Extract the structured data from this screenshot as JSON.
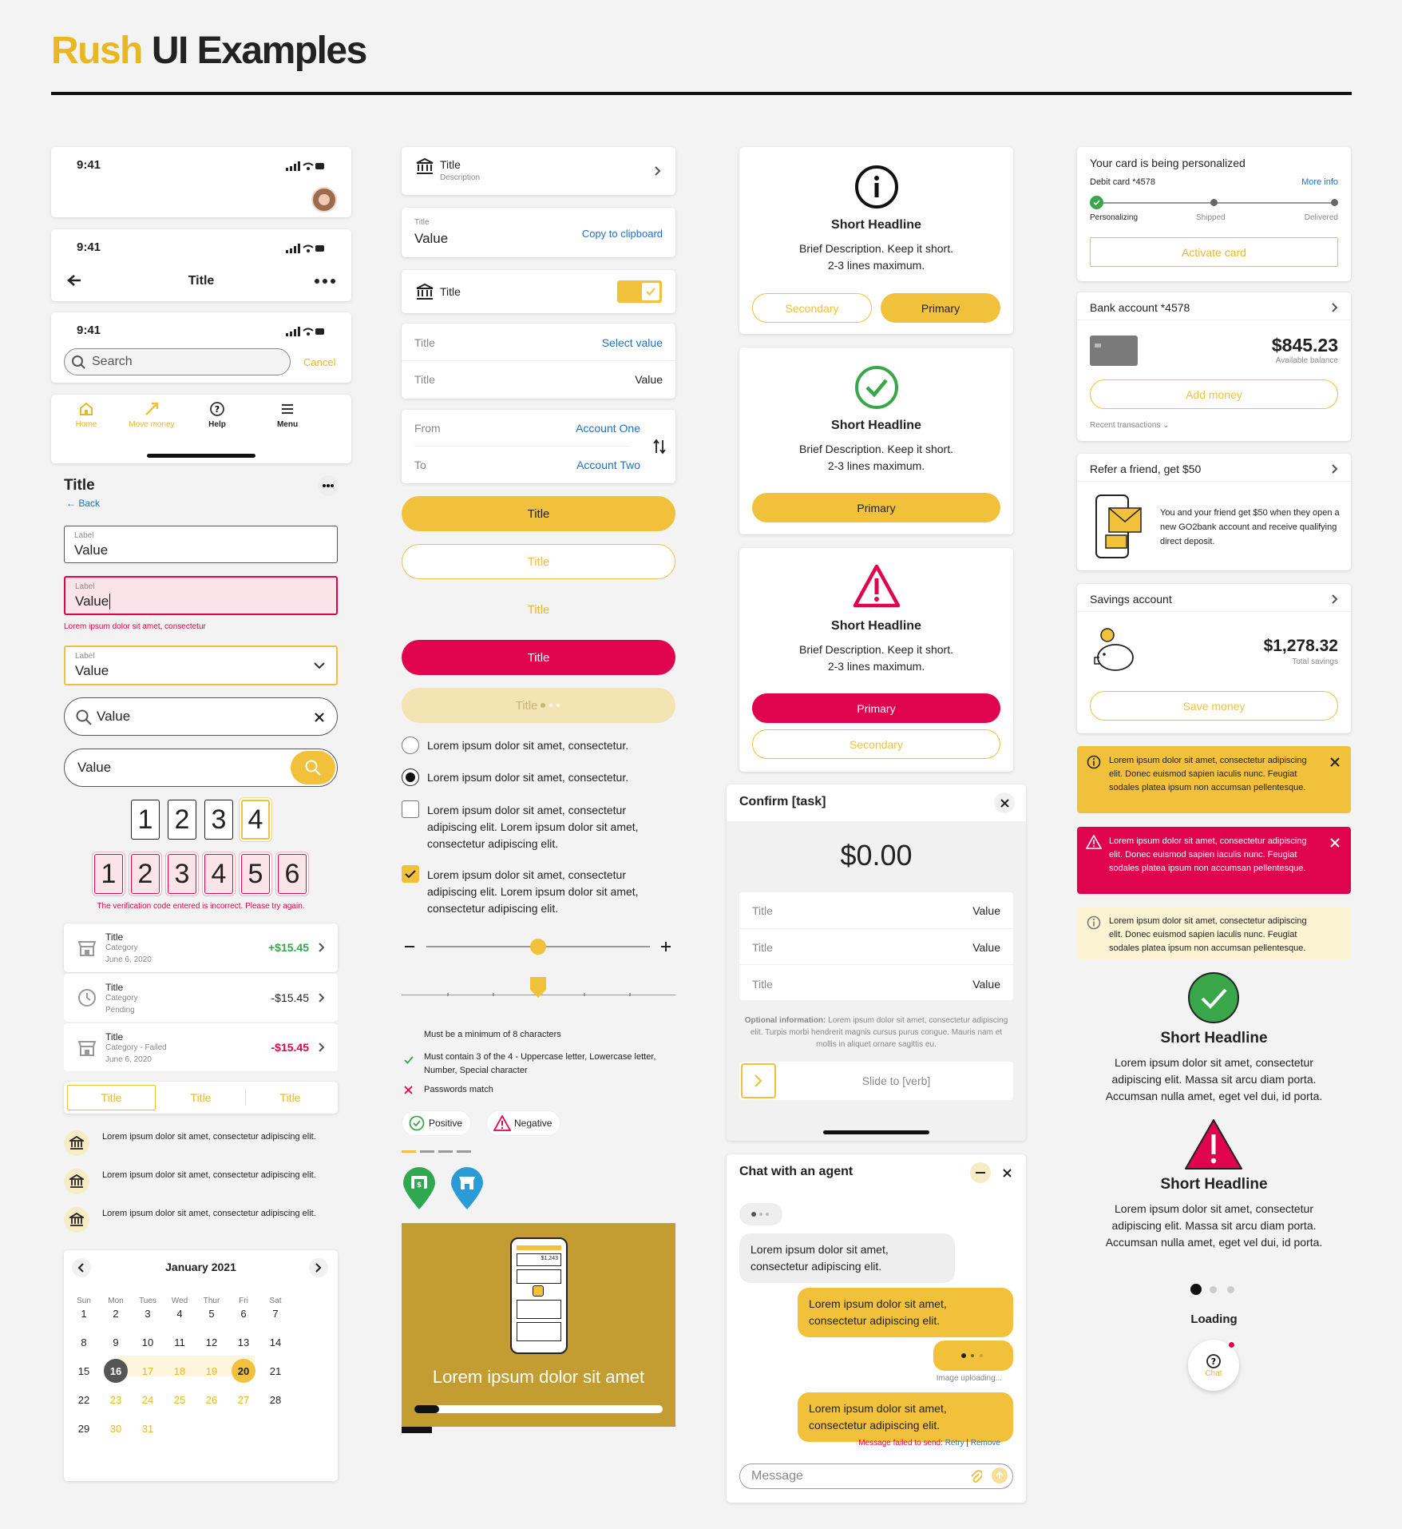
{
  "header": {
    "brand": "Rush",
    "title": " UI Examples"
  },
  "phone": {
    "time": "9:41",
    "nav_title": "Title",
    "search_placeholder": "Search",
    "cancel": "Cancel",
    "tabs": [
      {
        "label": "Home"
      },
      {
        "label": "Move money"
      },
      {
        "label": "Help"
      },
      {
        "label": "Menu"
      }
    ]
  },
  "form": {
    "page_title": "Title",
    "back": "Back",
    "label": "Label",
    "value": "Value",
    "error": "Lorem ipsum dolor sit amet, consectetur",
    "search_value": "Value",
    "search_value2": "Value",
    "code4": [
      "1",
      "2",
      "3",
      "4"
    ],
    "code6": [
      "1",
      "2",
      "3",
      "4",
      "5",
      "6"
    ],
    "code_error": "The verification code entered is incorrect. Please try again."
  },
  "transactions": [
    {
      "title": "Title",
      "category": "Category",
      "sub": "June 6, 2020",
      "amount": "+$15.45",
      "color": "#3aa64a"
    },
    {
      "title": "Title",
      "category": "Category",
      "sub": "Pending",
      "amount": "-$15.45",
      "color": "#222"
    },
    {
      "title": "Title",
      "category": "Category - Failed",
      "sub": "June 6, 2020",
      "amount": "-$15.45",
      "color": "#e0034d"
    }
  ],
  "seg": [
    "Title",
    "Title",
    "Title"
  ],
  "bank_items": [
    "Lorem ipsum dolor sit amet, consectetur adipiscing elit.",
    "Lorem ipsum dolor sit amet, consectetur adipiscing elit.",
    "Lorem ipsum dolor sit amet, consectetur adipiscing elit."
  ],
  "calendar": {
    "month": "January 2021",
    "days": [
      "Sun",
      "Mon",
      "Tues",
      "Wed",
      "Thur",
      "Fri",
      "Sat"
    ],
    "dates": [
      "1",
      "2",
      "3",
      "4",
      "5",
      "6",
      "7",
      "8",
      "9",
      "10",
      "11",
      "12",
      "13",
      "14",
      "15",
      "16",
      "17",
      "18",
      "19",
      "20",
      "21",
      "22",
      "23",
      "24",
      "25",
      "26",
      "27",
      "28",
      "29",
      "30",
      "31"
    ]
  },
  "col2": {
    "list_title": "Title",
    "list_desc": "Description",
    "copy_label": "Title",
    "copy_value": "Value",
    "copy_link": "Copy to clipboard",
    "toggle_title": "Title",
    "sel_title": "Title",
    "sel_link": "Select value",
    "val_title": "Title",
    "val_value": "Value",
    "from": "From",
    "from_val": "Account One",
    "to": "To",
    "to_val": "Account Two",
    "buttons": [
      "Title",
      "Title",
      "Title",
      "Title",
      "Title"
    ],
    "radio1": "Lorem ipsum dolor sit amet, consectetur.",
    "radio2": "Lorem ipsum dolor sit amet, consectetur.",
    "check1": "Lorem ipsum dolor sit amet, consectetur adipiscing elit. Lorem ipsum dolor sit amet, consectetur adipiscing elit.",
    "check2": "Lorem ipsum dolor sit amet, consectetur adipiscing elit. Lorem ipsum dolor sit amet, consectetur adipiscing elit.",
    "slider_value": 0.5,
    "pw1": "Must be a minimum of 8 characters",
    "pw2": "Must contain 3 of the 4 - Uppercase letter, Lowercase letter, Number, Special character",
    "pw3": "Passwords match",
    "positive": "Positive",
    "negative": "Negative",
    "promo": "Lorem ipsum dolor sit amet",
    "promo_progress": 0.1,
    "promo_balance": "$1,243"
  },
  "col3": {
    "headline": "Short Headline",
    "desc1": "Brief Description. Keep it short.",
    "desc2": "2-3 lines maximum.",
    "secondary": "Secondary",
    "primary": "Primary",
    "confirm_title": "Confirm [task]",
    "amount": "$0.00",
    "rows": [
      {
        "t": "Title",
        "v": "Value"
      },
      {
        "t": "Title",
        "v": "Value"
      },
      {
        "t": "Title",
        "v": "Value"
      }
    ],
    "optional_label": "Optional information:",
    "optional": " Lorem ipsum dolor sit amet, consectetur adipiscing elit. Turpis morbi hendrerit magnis cursus purus congue. Mauris nam et mollis in aliquet ornare sagittis eu.",
    "slide": "Slide to [verb]",
    "chat_title": "Chat with an agent",
    "msg_agent": "Lorem ipsum dolor sit amet, consectetur adipiscing elit.",
    "msg_user": "Lorem ipsum dolor sit amet, consectetur adipiscing elit.",
    "uploading": "Image uploading...",
    "msg_user2": "Lorem ipsum dolor sit amet, consectetur adipiscing elit.",
    "failed": "Message failed to send:",
    "retry": "Retry",
    "remove": "Remove",
    "message_ph": "Message"
  },
  "col4": {
    "personalize": "Your card is being personalized",
    "debit": "Debit card *4578",
    "more": "More info",
    "steps": [
      "Personalizing",
      "Shipped",
      "Delivered"
    ],
    "activate": "Activate card",
    "bank": "Bank account *4578",
    "balance": "$845.23",
    "avail": "Available balance",
    "add": "Add money",
    "recent": "Recent transactions",
    "refer": "Refer a friend, get $50",
    "refer_text": "You and your friend get $50 when they open a new GO2bank account and receive qualifying direct deposit.",
    "savings": "Savings account",
    "sav_amount": "$1,278.32",
    "sav_label": "Total savings",
    "save": "Save money",
    "alert": "Lorem ipsum dolor sit amet, consectetur adipiscing elit. Donec euismod sapien iaculis nunc. Feugiat sodales platea ipsum non accumsan pellentesque.",
    "headline": "Short Headline",
    "body": "Lorem ipsum dolor sit amet, consectetur adipiscing elit. Massa sit arcu diam porta. Accumsan nulla amet, eget vel dui, id porta.",
    "loading": "Loading",
    "chat": "Chat"
  },
  "colors": {
    "gold": "#f2c13c",
    "red": "#e0034d",
    "green": "#3aa64a",
    "blue": "#1e6fc9"
  }
}
